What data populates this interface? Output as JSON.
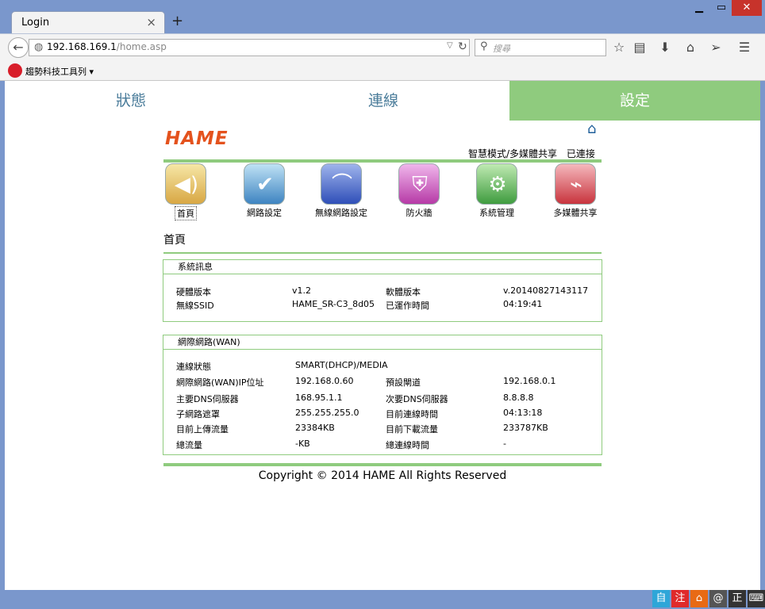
{
  "browser": {
    "tab_title": "Login",
    "tab_close": "×",
    "new_tab": "+",
    "url_host": "192.168.169.1",
    "url_path": "/home.asp",
    "search_placeholder": "搜尋",
    "bookmark_toolbar": "趨勢科技工具列 ▾",
    "win_min": "▁",
    "win_max": "▭",
    "win_close": "✕"
  },
  "topnav": {
    "status": "狀態",
    "connection": "連線",
    "settings": "設定"
  },
  "header": {
    "logo": "HAME",
    "mode": "智慧模式/多媒體共享",
    "state": "已連接"
  },
  "menu": [
    {
      "label": "首頁",
      "icon": "home-sound-icon",
      "color": "#e8c66a"
    },
    {
      "label": "網路設定",
      "icon": "globe-check-icon",
      "color": "#4d8fc6"
    },
    {
      "label": "無線網路設定",
      "icon": "wireless-icon",
      "color": "#3f5fc2"
    },
    {
      "label": "防火牆",
      "icon": "shield-icon",
      "color": "#c64ab8"
    },
    {
      "label": "系統管理",
      "icon": "gear-lock-icon",
      "color": "#55b455"
    },
    {
      "label": "多媒體共享",
      "icon": "usb-drive-icon",
      "color": "#d84a52"
    }
  ],
  "page_title": "首頁",
  "system_info": {
    "title": "系統訊息",
    "hw_label": "硬體版本",
    "hw_value": "v1.2",
    "sw_label": "軟體版本",
    "sw_value": "v.20140827143117",
    "ssid_label": "無線SSID",
    "ssid_value": "HAME_SR-C3_8d05",
    "uptime_label": "已運作時間",
    "uptime_value": "04:19:41"
  },
  "wan": {
    "title": "網際網路(WAN)",
    "conn_label": "連線狀態",
    "conn_value": "SMART(DHCP)/MEDIA",
    "ip_label": "網際網路(WAN)IP位址",
    "ip_value": "192.168.0.60",
    "gw_label": "預設閘道",
    "gw_value": "192.168.0.1",
    "dns1_label": "主要DNS伺服器",
    "dns1_value": "168.95.1.1",
    "dns2_label": "次要DNS伺服器",
    "dns2_value": "8.8.8.8",
    "mask_label": "子網路遮罩",
    "mask_value": "255.255.255.0",
    "ctime_label": "目前連線時間",
    "ctime_value": "04:13:18",
    "up_label": "目前上傳流量",
    "up_value": "23384KB",
    "down_label": "目前下載流量",
    "down_value": "233787KB",
    "total_label": "總流量",
    "total_value": "-KB",
    "ttime_label": "總連線時間",
    "ttime_value": "-"
  },
  "footer": {
    "copyright": "Copyright © 2014 HAME All Rights Reserved"
  },
  "ime_bar": [
    "自",
    "注",
    "⌂",
    "@",
    "正",
    "⌨"
  ]
}
